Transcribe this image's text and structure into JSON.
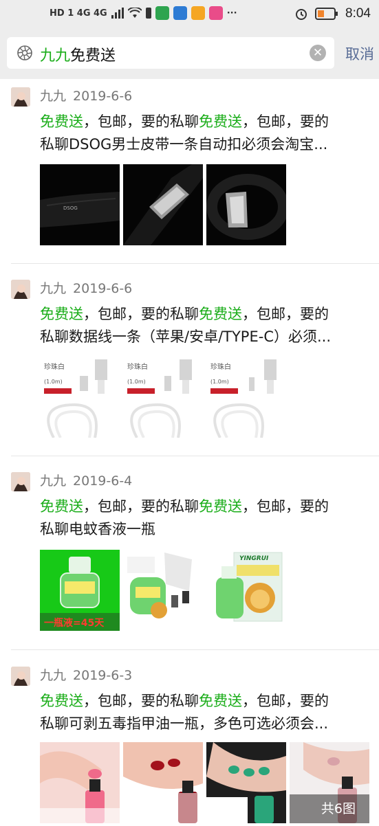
{
  "status_bar": {
    "network": "HD 1  4G  4G",
    "time": "8:04"
  },
  "search": {
    "query_highlight": "九九",
    "query_rest": "免费送",
    "cancel_label": "取消"
  },
  "colors": {
    "highlight": "#1aad19",
    "link": "#576b95"
  },
  "posts": [
    {
      "author": "九九",
      "date": "2019-6-6",
      "line1": [
        {
          "t": "免费送",
          "h": true
        },
        {
          "t": "，包邮，要的私聊",
          "h": false
        },
        {
          "t": "免费送",
          "h": true
        },
        {
          "t": "，包邮，要的",
          "h": false
        }
      ],
      "line2": "私聊DSOG男士皮带一条自动扣必须会淘宝...",
      "images": [
        "belt-photo",
        "belt-buckle-photo",
        "belt-buckle-photo"
      ]
    },
    {
      "author": "九九",
      "date": "2019-6-6",
      "line1": [
        {
          "t": "免费送",
          "h": true
        },
        {
          "t": "，包邮，要的私聊",
          "h": false
        },
        {
          "t": "免费送",
          "h": true
        },
        {
          "t": "，包邮，要的",
          "h": false
        }
      ],
      "line2": "私聊数据线一条（苹果/安卓/TYPE-C）必须...",
      "images": [
        "cable-photo",
        "cable-photo",
        "cable-photo"
      ],
      "image_labels": [
        {
          "color": "珍珠白",
          "length": "(1.0m)"
        },
        {
          "color": "珍珠白",
          "length": "(1.0m)"
        },
        {
          "color": "珍珠白",
          "length": "(1.0m)"
        }
      ]
    },
    {
      "author": "九九",
      "date": "2019-6-4",
      "line1": [
        {
          "t": "免费送",
          "h": true
        },
        {
          "t": "，包邮，要的私聊",
          "h": false
        },
        {
          "t": "免费送",
          "h": true
        },
        {
          "t": "，包邮，要的",
          "h": false
        }
      ],
      "line2": "私聊电蚊香液一瓶",
      "images": [
        "mosquito-liquid-photo",
        "mosquito-liquid-photo",
        "mosquito-liquid-box-photo"
      ],
      "first_image_caption": "一瓶液=45天",
      "box_brand": "YINGRUI"
    },
    {
      "author": "九九",
      "date": "2019-6-3",
      "line1": [
        {
          "t": "免费送",
          "h": true
        },
        {
          "t": "，包邮，要的私聊",
          "h": false
        },
        {
          "t": "免费送",
          "h": true
        },
        {
          "t": "，包邮，要的",
          "h": false
        }
      ],
      "line2": "私聊可剥五毒指甲油一瓶，多色可选必须会...",
      "images": [
        "nail-polish-photo",
        "nail-polish-photo",
        "nail-polish-photo",
        "nail-polish-photo"
      ],
      "image_count": "共6图"
    }
  ]
}
